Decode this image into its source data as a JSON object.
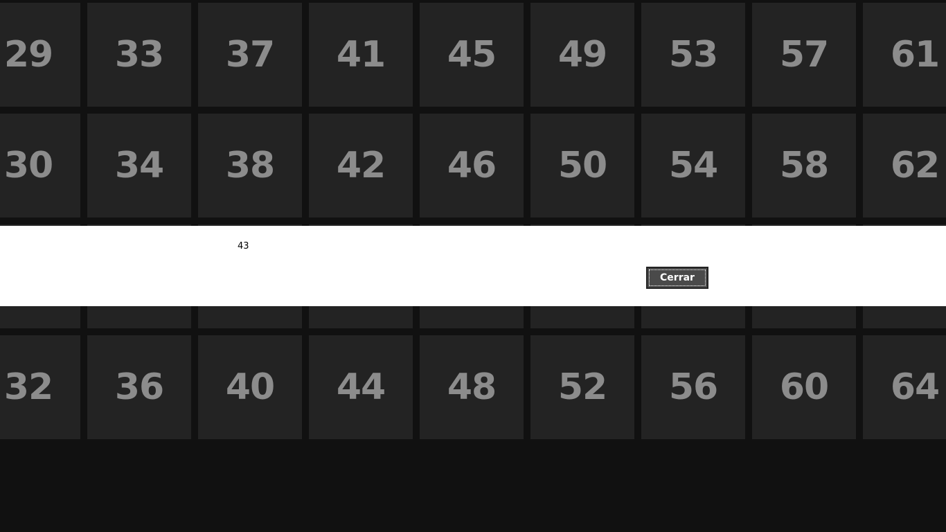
{
  "tiles": {
    "rows": [
      [
        "29",
        "33",
        "37",
        "41",
        "45",
        "49",
        "53",
        "57",
        "61"
      ],
      [
        "30",
        "34",
        "38",
        "42",
        "46",
        "50",
        "54",
        "58",
        "62"
      ],
      [
        "",
        "",
        "",
        "",
        "",
        "",
        "",
        "",
        ""
      ],
      [
        "32",
        "36",
        "40",
        "44",
        "48",
        "52",
        "56",
        "60",
        "64"
      ]
    ]
  },
  "dialog": {
    "message": "43",
    "close_label": "Cerrar"
  },
  "colors": {
    "background": "#111111",
    "tile": "#232323",
    "tile_text": "#8c8c8c",
    "dialog_bg": "#ffffff",
    "button_bg": "#4a4a4a"
  }
}
